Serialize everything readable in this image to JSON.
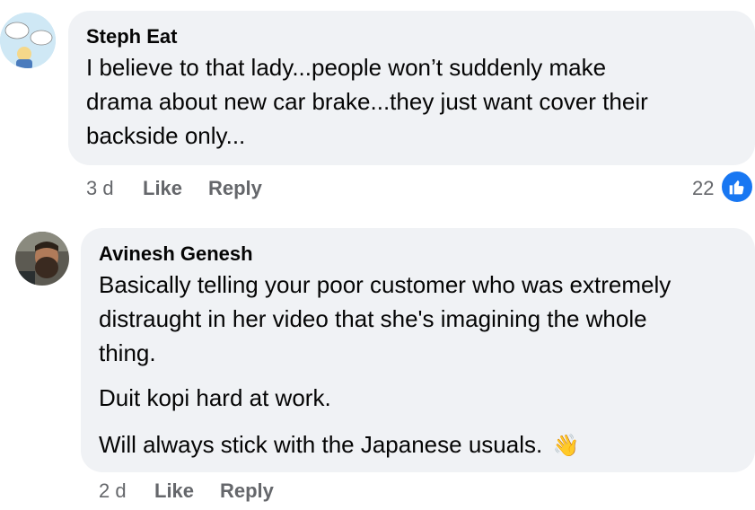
{
  "comments": [
    {
      "author": "Steph Eat",
      "lines": [
        "I believe to that lady...people won’t suddenly make",
        "drama about new car brake...they just want cover their",
        "backside only..."
      ],
      "time": "3 d",
      "like_label": "Like",
      "reply_label": "Reply",
      "reaction_count": "22",
      "reaction_icon": "like-reaction-icon"
    },
    {
      "author": "Avinesh Genesh",
      "lines": [
        "Basically telling your poor customer who was extremely",
        "distraught in her video that she's imagining the whole",
        "thing."
      ],
      "line2": "Duit kopi hard at work.",
      "line3": "Will always stick with the Japanese usuals.",
      "emoji": "👋",
      "time": "2 d",
      "like_label": "Like",
      "reply_label": "Reply"
    }
  ],
  "colors": {
    "bubble": "#f0f2f5",
    "meta": "#65676b",
    "like_blue": "#1877f2"
  }
}
